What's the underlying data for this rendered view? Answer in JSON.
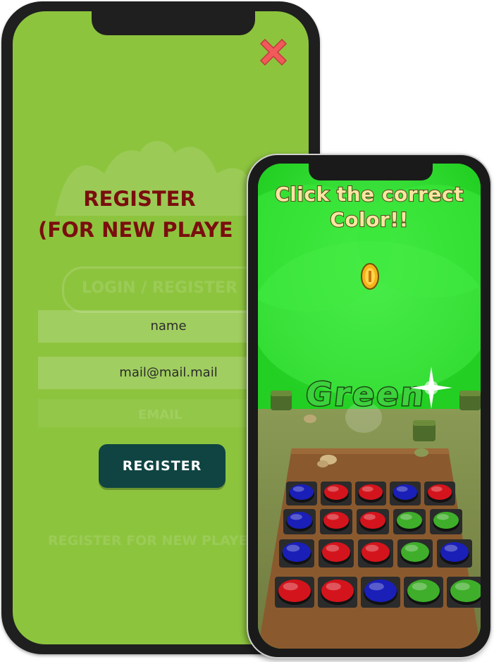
{
  "register_screen": {
    "close_icon": "close-x-icon",
    "title_line1": "REGISTER",
    "title_line2": "(FOR NEW PLAYE",
    "name_field": "name",
    "mail_field": "mail@mail.mail",
    "register_button": "REGISTER",
    "background_color": "#8dc43e",
    "title_color": "#7a0e0e",
    "button_color": "#0f4442",
    "faded_background_text": {
      "login_register": "LOGIN / REGISTER",
      "register_new_player": "REGISTER FOR NEW PLAYER",
      "field_hint": "EMAIL"
    }
  },
  "game_screen": {
    "instruction_line1": "Click the correct",
    "instruction_line2": "Color!!",
    "target_color_word": "Green",
    "coin_icon": "coin-icon",
    "sparkle_icon": "sparkle-icon",
    "sky_color": "#2fe22f",
    "board_color": "#8a5a2e",
    "button_grid": [
      [
        "blue",
        "red",
        "red",
        "blue",
        "red"
      ],
      [
        "blue",
        "red",
        "red",
        "green",
        "green"
      ],
      [
        "blue",
        "red",
        "red",
        "green",
        "blue"
      ],
      [
        "red",
        "red",
        "blue",
        "green",
        "green"
      ]
    ],
    "button_colors": {
      "red": "#d4141c",
      "blue": "#1a1fb8",
      "green": "#3fae2a"
    }
  }
}
